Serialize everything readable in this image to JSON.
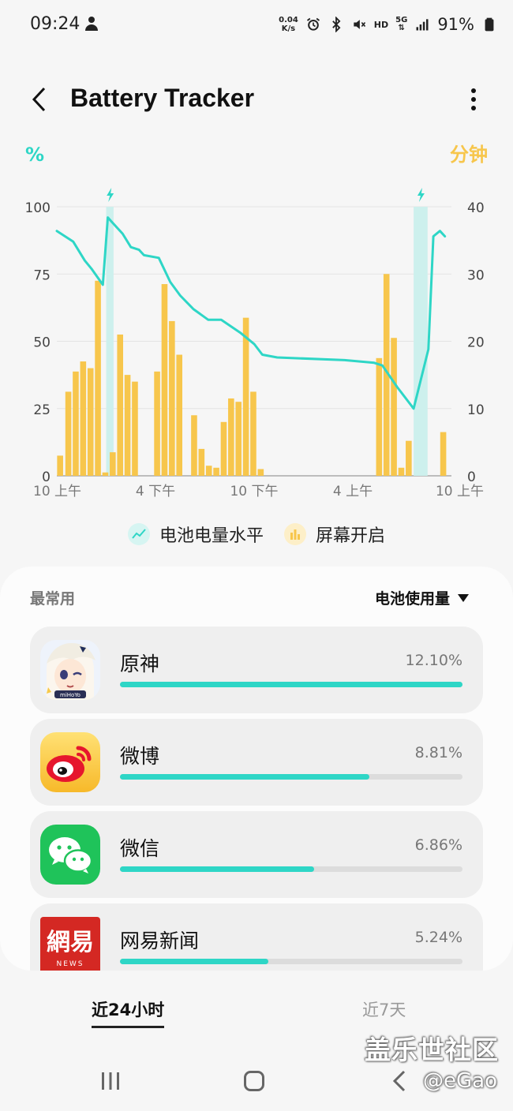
{
  "status": {
    "time": "09:24",
    "net_speed_value": "0.04",
    "net_speed_unit": "K/s",
    "hd": "HD",
    "network": "5G",
    "battery": "91%"
  },
  "header": {
    "title": "Battery Tracker"
  },
  "chart_data": {
    "type": "bar+line",
    "y_left_unit": "%",
    "y_right_unit": "分钟",
    "y_left_ticks": [
      "100",
      "75",
      "50",
      "25",
      "0"
    ],
    "y_right_ticks": [
      "40",
      "30",
      "20",
      "10",
      "0"
    ],
    "ylim_left": [
      0,
      100
    ],
    "ylim_right": [
      0,
      40
    ],
    "x_range_hours": [
      0,
      24
    ],
    "x_ticks": [
      {
        "t": 0,
        "label": "10 上午"
      },
      {
        "t": 6,
        "label": "4 下午"
      },
      {
        "t": 12,
        "label": "10 下午"
      },
      {
        "t": 18,
        "label": "4 上午"
      },
      {
        "t": 24,
        "label": "10 上午"
      }
    ],
    "charging_periods_hours": [
      [
        3.0,
        3.45
      ],
      [
        21.7,
        22.55
      ]
    ],
    "grid": true,
    "legend": [
      {
        "name": "电池电量水平",
        "color": "#2ed6c6"
      },
      {
        "name": "屏幕开启",
        "color": "#f7c64c"
      }
    ],
    "battery_level": {
      "name": "电池电量水平",
      "t": [
        0,
        1.0,
        1.7,
        2.1,
        2.8,
        3.1,
        3.4,
        4.0,
        4.5,
        5.0,
        5.3,
        6.2,
        6.9,
        7.5,
        8.3,
        9.2,
        10.0,
        11.2,
        12.0,
        12.5,
        13.4,
        17.5,
        19.3,
        19.8,
        20.7,
        21.7,
        22.6,
        22.9,
        23.3,
        23.6
      ],
      "values": [
        91,
        87,
        80,
        77,
        71,
        96,
        94,
        90,
        85,
        84,
        82,
        81,
        72,
        67,
        62,
        58,
        58,
        53,
        49,
        45,
        44,
        43,
        42,
        41,
        33,
        25,
        47,
        89,
        91,
        89
      ]
    },
    "screen_on_minutes": {
      "name": "屏幕开启",
      "t": [
        0.2,
        0.7,
        1.15,
        1.6,
        2.05,
        2.5,
        2.95,
        3.4,
        3.85,
        4.3,
        4.75,
        5.2,
        6.1,
        6.55,
        7.0,
        7.45,
        8.35,
        8.8,
        9.25,
        9.7,
        10.15,
        10.6,
        11.05,
        11.5,
        11.95,
        12.4,
        12.85,
        19.6,
        20.05,
        20.5,
        20.95,
        21.4,
        23.5
      ],
      "values": [
        3,
        12.5,
        15.5,
        17,
        16,
        29,
        0.5,
        3.5,
        21,
        15,
        14,
        0,
        15.5,
        28.5,
        23,
        18,
        9,
        4,
        1.5,
        1.2,
        8,
        11.5,
        11,
        23.5,
        12.5,
        1,
        0,
        17.5,
        30,
        20.5,
        1.2,
        5.2,
        6.5
      ]
    }
  },
  "legend": {
    "battery_label": "电池电量水平",
    "screen_label": "屏幕开启"
  },
  "usage": {
    "section_label": "最常用",
    "sort_label": "电池使用量",
    "apps": [
      {
        "name": "原神",
        "percent": "12.10%",
        "fraction": 1.0,
        "icon": "genshin-app-icon"
      },
      {
        "name": "微博",
        "percent": "8.81%",
        "fraction": 0.728,
        "icon": "weibo-app-icon"
      },
      {
        "name": "微信",
        "percent": "6.86%",
        "fraction": 0.567,
        "icon": "wechat-app-icon"
      },
      {
        "name": "网易新闻",
        "percent": "5.24%",
        "fraction": 0.433,
        "icon": "netease-news-app-icon"
      }
    ]
  },
  "icons": {
    "genshin_badge": "miHoYo",
    "netease_logo": "網易",
    "netease_sub": "NEWS"
  },
  "tabs": {
    "last_24h": "近24小时",
    "last_7d": "近7天"
  },
  "watermark": {
    "line1": "盖乐世社区",
    "line2": "@eGao"
  },
  "colors": {
    "accent_teal": "#2ed6c6",
    "bar_yellow": "#f7c64c",
    "charge_band": "#cdf0ed"
  }
}
